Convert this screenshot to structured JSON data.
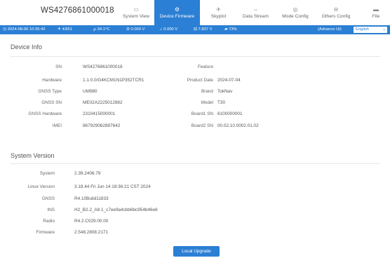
{
  "header": {
    "device_sn": "WS4276861000018",
    "tabs": [
      {
        "label": "System View",
        "icon": "monitor-icon"
      },
      {
        "label": "Device Firmware",
        "icon": "gear-icon"
      },
      {
        "label": "Skyplot",
        "icon": "satellite-icon"
      },
      {
        "label": "Data Stream",
        "icon": "stream-icon"
      },
      {
        "label": "Mode Config",
        "icon": "config-icon"
      },
      {
        "label": "Others Config",
        "icon": "settings-icon"
      },
      {
        "label": "File",
        "icon": "folder-icon"
      }
    ],
    "active_tab": "Device Firmware"
  },
  "status": {
    "datetime": "2024-08-06 10:35:42",
    "satellites": "43/51",
    "temperature": "34.1°C",
    "voltage1": "0.000 V",
    "voltage2": "0.000 V",
    "voltage3": "7.837 V",
    "battery": "73%",
    "advance_ui": "(Advance UI)",
    "language": "English"
  },
  "device_info": {
    "title": "Device Info",
    "left": [
      {
        "label": "SN",
        "value": "WS4276861000018"
      },
      {
        "label": "Hardware",
        "value": "1.1.0.0/G4KCM1N1P352TCR1"
      },
      {
        "label": "GNSS Type",
        "value": "UM980"
      },
      {
        "label": "GNSS SN",
        "value": "ME02A2225012882"
      },
      {
        "label": "GNSS Hardware",
        "value": "2310415000001"
      },
      {
        "label": "IMEI",
        "value": "867929062897642"
      }
    ],
    "right": [
      {
        "label": "Feature",
        "value": ""
      },
      {
        "label": "Product Date",
        "value": "2024-07-04"
      },
      {
        "label": "Brand",
        "value": "TokNav"
      },
      {
        "label": "Model",
        "value": "T30"
      },
      {
        "label": "Board1 SN",
        "value": "6100000001"
      },
      {
        "label": "Board2 SN",
        "value": "00.02.10.0002.01.02"
      }
    ]
  },
  "system_version": {
    "title": "System Version",
    "rows": [
      {
        "label": "System",
        "value": "2.39.2406.79"
      },
      {
        "label": "Linux Version",
        "value": "3.18.44 Fri Jun 14 18:36:21 CST 2024"
      },
      {
        "label": "GNSS",
        "value": "R4.10Build11833"
      },
      {
        "label": "INS",
        "value": "H2_B2.2_A8.1_c7ee9a4cbb6bc954b46e6"
      },
      {
        "label": "Radio",
        "value": "R4.2.C029.00.00"
      },
      {
        "label": "Firmware",
        "value": "2.548.2808.2171"
      }
    ]
  },
  "actions": {
    "local_upgrade": "Local Upgrade"
  }
}
